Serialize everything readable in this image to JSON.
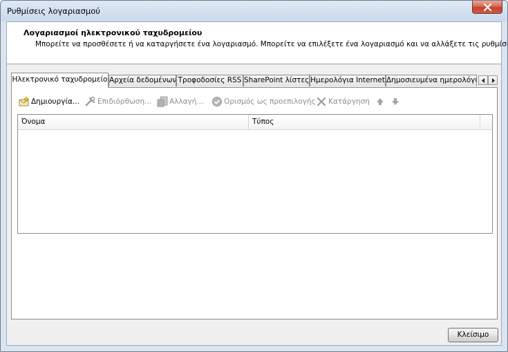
{
  "window": {
    "title": "Ρυθμίσεις λογαριασμού"
  },
  "header": {
    "title": "Λογαριασμοί ηλεκτρονικού ταχυδρομείου",
    "description": "Μπορείτε να προσθέσετε ή να καταργήσετε ένα λογαριασμό. Μπορείτε να επιλέξετε ένα λογαριασμό και να αλλάξετε τις ρυθμίσεις του."
  },
  "tabs": [
    {
      "label": "Ηλεκτρονικό ταχυδρομείο",
      "active": true
    },
    {
      "label": "Αρχεία δεδομένων",
      "active": false
    },
    {
      "label": "Τροφοδοσίες RSS",
      "active": false
    },
    {
      "label": "SharePoint λίστες",
      "active": false
    },
    {
      "label": "Ημερολόγια Internet",
      "active": false
    },
    {
      "label": "Δημοσιευμένα ημερολόγια",
      "active": false
    }
  ],
  "toolbar": {
    "new_label": "Δημιουργία...",
    "repair_label": "Επιδιόρθωση...",
    "change_label": "Αλλαγή...",
    "set_default_label": "Ορισμός ως προεπιλογής",
    "remove_label": "Κατάργηση"
  },
  "list": {
    "columns": [
      "Όνομα",
      "Τύπος"
    ],
    "rows": []
  },
  "footer": {
    "close_label": "Κλείσιμο"
  },
  "colors": {
    "accent": "#c3432c",
    "disabled_text": "#8d8d8d",
    "frame": "#dbe5f1"
  }
}
